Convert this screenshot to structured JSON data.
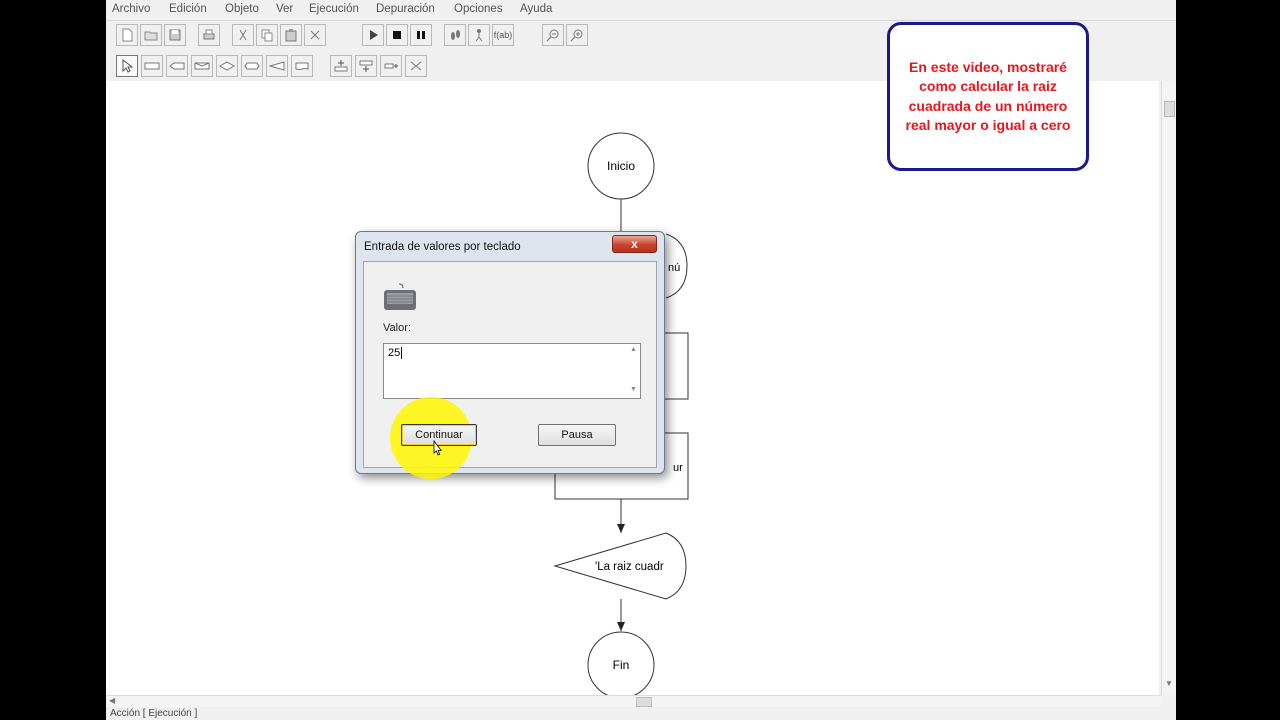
{
  "menu": [
    "Archivo",
    "Edición",
    "Objeto",
    "Ver",
    "Ejecución",
    "Depuración",
    "Opciones",
    "Ayuda"
  ],
  "toolbar": {
    "debug_label": "f(ab)"
  },
  "flowchart": {
    "start": "Inicio",
    "read_partial": "nú",
    "assign_partial": "ur",
    "output": "'La raiz cuadr",
    "end": "Fin"
  },
  "annotation": {
    "text": "En este video, mostraré como calcular la raiz cuadrada de un número real mayor o igual a cero",
    "color": "#e8161d",
    "border_color": "#1a1a8c"
  },
  "dialog": {
    "title": "Entrada de valores por teclado",
    "close_glyph": "x",
    "value_label": "Valor:",
    "value": "25",
    "continue_label": "Continuar",
    "pause_label": "Pausa"
  },
  "status": "Acción [ Ejecución ]"
}
